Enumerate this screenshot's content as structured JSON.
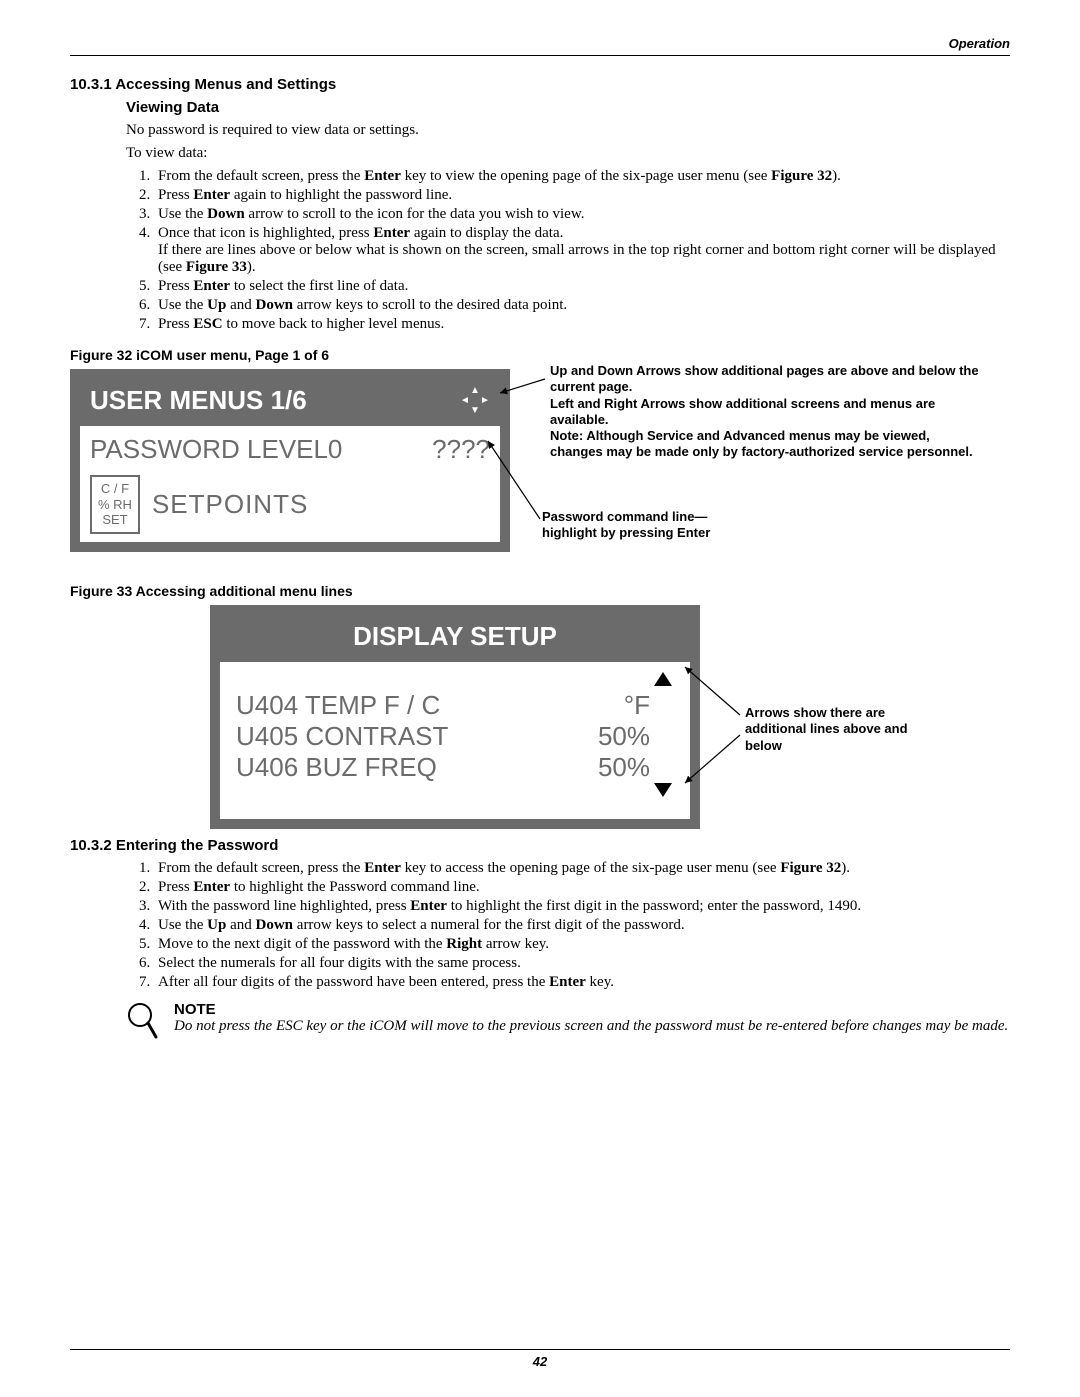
{
  "header": {
    "section": "Operation"
  },
  "section1": {
    "num": "10.3.1",
    "title": "Accessing Menus and Settings",
    "sub": "Viewing Data",
    "para1": "No password is required to view data or settings.",
    "para2": "To view data:",
    "steps": [
      {
        "pre": "From the default screen, press the ",
        "bold1": "Enter",
        "mid": " key to view the opening page of the six-page user menu (see ",
        "bold2": "Figure 32",
        "post": ")."
      },
      {
        "pre": "Press ",
        "bold1": "Enter",
        "post": " again to highlight the password line."
      },
      {
        "pre": "Use the ",
        "bold1": "Down",
        "post": " arrow to scroll to the icon for the data you wish to view."
      },
      {
        "pre": "Once that icon is highlighted, press ",
        "bold1": "Enter",
        "post": " again to display the data.",
        "extra_pre": "If there are lines above or below what is shown on the screen, small arrows in the top right corner and bottom right corner will be displayed (see ",
        "extra_bold": "Figure 33",
        "extra_post": ")."
      },
      {
        "pre": "Press ",
        "bold1": "Enter",
        "post": " to select the first line of data."
      },
      {
        "pre": "Use the ",
        "bold1": "Up",
        "mid": " and ",
        "bold2": "Down",
        "post": " arrow keys to scroll to the desired data point."
      },
      {
        "pre": "Press ",
        "bold1": "ESC",
        "post": " to move back to higher level menus."
      }
    ]
  },
  "figure32": {
    "caption": "Figure 32  iCOM user menu, Page 1 of 6",
    "lcd": {
      "title": "USER MENUS 1/6",
      "pw_label": "PASSWORD LEVEL0",
      "pw_val": "????",
      "box_l1": "C / F",
      "box_l2": "% RH",
      "box_l3": "SET",
      "setpoints": "SETPOINTS"
    },
    "annot1": "Up and Down Arrows show additional pages are above and below the current page.",
    "annot1b": "Left and Right Arrows show additional screens and menus are available.",
    "annot1c": "Note: Although Service and Advanced menus may be viewed, changes may be made only by factory-authorized service personnel.",
    "annot2": "Password command line—highlight by pressing Enter"
  },
  "figure33": {
    "caption": "Figure 33  Accessing additional menu lines",
    "lcd": {
      "title": "DISPLAY SETUP",
      "rows": [
        {
          "label": "U404 TEMP F / C",
          "val": "°F"
        },
        {
          "label": "U405 CONTRAST",
          "val": "50%"
        },
        {
          "label": "U406 BUZ FREQ",
          "val": "50%"
        }
      ]
    },
    "annot": "Arrows show there are additional lines above and below"
  },
  "section2": {
    "num": "10.3.2",
    "title": "Entering the Password",
    "steps": [
      {
        "pre": "From the default screen, press the ",
        "bold1": "Enter",
        "mid": " key to access the opening page of the six-page user menu (see ",
        "bold2": "Figure 32",
        "post": ")."
      },
      {
        "pre": "Press ",
        "bold1": "Enter",
        "post": " to highlight the Password command line."
      },
      {
        "pre": "With the password line highlighted, press ",
        "bold1": "Enter",
        "post": " to highlight the first digit in the password; enter the password, 1490."
      },
      {
        "pre": "Use the ",
        "bold1": "Up",
        "mid": " and ",
        "bold2": "Down",
        "post": " arrow keys to select a numeral for the first digit of the password."
      },
      {
        "pre": "Move to the next digit of the password with the ",
        "bold1": "Right",
        "post": " arrow key."
      },
      {
        "pre": "",
        "post": "Select the numerals for all four digits with the same process."
      },
      {
        "pre": "After all four digits of the password have been entered, press the ",
        "bold1": "Enter",
        "post": " key."
      }
    ],
    "note_title": "NOTE",
    "note_text": "Do not press the ESC key or the iCOM will move to the previous screen and the password must be re-entered before changes may be made."
  },
  "footer": {
    "page": "42"
  }
}
